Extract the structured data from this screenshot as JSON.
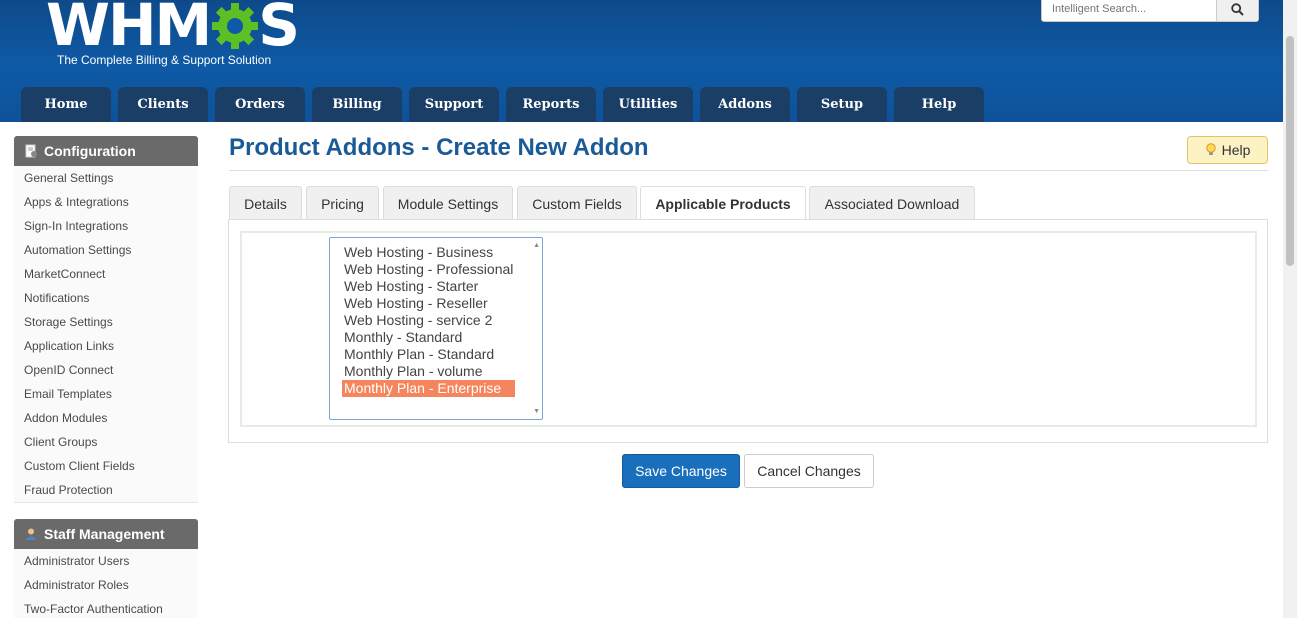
{
  "header": {
    "logo_text": "WHMCS",
    "tagline": "The Complete Billing & Support Solution",
    "search_placeholder": "Intelligent Search..."
  },
  "nav": [
    {
      "label": "Home"
    },
    {
      "label": "Clients"
    },
    {
      "label": "Orders"
    },
    {
      "label": "Billing"
    },
    {
      "label": "Support"
    },
    {
      "label": "Reports"
    },
    {
      "label": "Utilities"
    },
    {
      "label": "Addons"
    },
    {
      "label": "Setup"
    },
    {
      "label": "Help"
    }
  ],
  "sidebar": {
    "configuration": {
      "title": "Configuration",
      "items": [
        "General Settings",
        "Apps & Integrations",
        "Sign-In Integrations",
        "Automation Settings",
        "MarketConnect",
        "Notifications",
        "Storage Settings",
        "Application Links",
        "OpenID Connect",
        "Email Templates",
        "Addon Modules",
        "Client Groups",
        "Custom Client Fields",
        "Fraud Protection"
      ]
    },
    "staff": {
      "title": "Staff Management",
      "items": [
        "Administrator Users",
        "Administrator Roles",
        "Two-Factor Authentication"
      ]
    }
  },
  "main": {
    "title": "Product Addons - Create New Addon",
    "help_label": "Help",
    "tabs": [
      {
        "label": "Details"
      },
      {
        "label": "Pricing"
      },
      {
        "label": "Module Settings"
      },
      {
        "label": "Custom Fields"
      },
      {
        "label": "Applicable Products",
        "active": true
      },
      {
        "label": "Associated Download"
      }
    ],
    "products": [
      {
        "label": "Web Hosting - Business"
      },
      {
        "label": "Web Hosting - Professional"
      },
      {
        "label": "Web Hosting - Starter"
      },
      {
        "label": "Web Hosting - Reseller"
      },
      {
        "label": "Web Hosting - service 2"
      },
      {
        "label": "Monthly - Standard"
      },
      {
        "label": "Monthly Plan - Standard"
      },
      {
        "label": "Monthly Plan - volume"
      },
      {
        "label": "Monthly Plan - Enterprise",
        "selected": true
      }
    ],
    "save_label": "Save Changes",
    "cancel_label": "Cancel Changes"
  },
  "colors": {
    "header_blue": "#0f5aa6",
    "nav_tab": "#1a3e66",
    "title_blue": "#1a5a96",
    "selection": "#f5855c",
    "primary_button": "#1a6fbd"
  }
}
